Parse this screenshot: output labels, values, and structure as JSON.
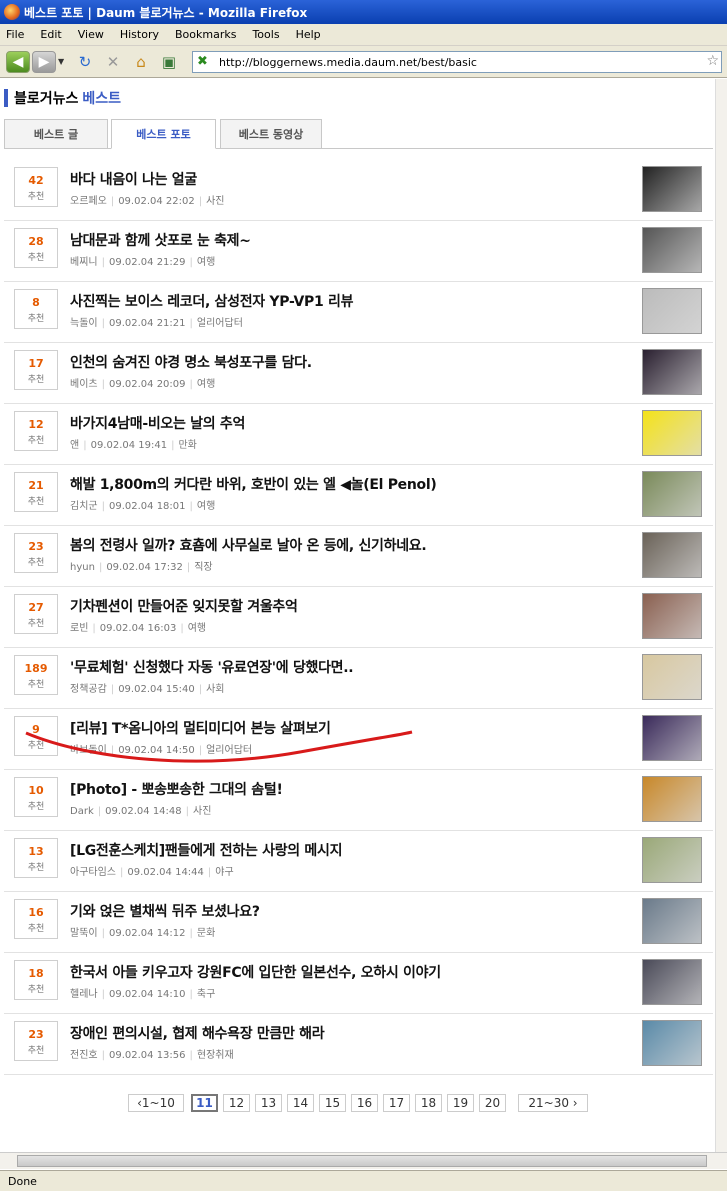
{
  "window": {
    "title": "베스트 포토 | Daum 블로거뉴스 - Mozilla Firefox"
  },
  "menu": [
    "File",
    "Edit",
    "View",
    "History",
    "Bookmarks",
    "Tools",
    "Help"
  ],
  "toolbar": {
    "url": "http://bloggernews.media.daum.net/best/basic"
  },
  "header": {
    "brand_main": "블로거뉴스",
    "brand_accent": "베스트"
  },
  "tabs": [
    {
      "label": "베스트 글",
      "active": false
    },
    {
      "label": "베스트 포토",
      "active": true
    },
    {
      "label": "베스트 동영상",
      "active": false
    }
  ],
  "vote_label": "추천",
  "items": [
    {
      "votes": "42",
      "title": "바다 내음이 나는 얼굴",
      "author": "오르페오",
      "date": "09.02.04 22:02",
      "category": "사진",
      "thumb_color": "#222"
    },
    {
      "votes": "28",
      "title": "남대문과 함께 삿포로 눈 축제~",
      "author": "베찌니",
      "date": "09.02.04 21:29",
      "category": "여행",
      "thumb_color": "#555"
    },
    {
      "votes": "8",
      "title": "사진찍는 보이스 레코더, 삼성전자 YP-VP1 리뷰",
      "author": "늑돌이",
      "date": "09.02.04 21:21",
      "category": "얼리어답터",
      "thumb_color": "#bbb"
    },
    {
      "votes": "17",
      "title": "인천의 숨겨진 야경 명소 북성포구를 담다.",
      "author": "베이츠",
      "date": "09.02.04 20:09",
      "category": "여행",
      "thumb_color": "#2a2030"
    },
    {
      "votes": "12",
      "title": "바가지4남매-비오는 날의 추억",
      "author": "앤",
      "date": "09.02.04 19:41",
      "category": "만화",
      "thumb_color": "#f4e21a"
    },
    {
      "votes": "21",
      "title": "해발 1,800m의 커다란 바위, 호반이 있는 엘 ◀놀(El Penol)",
      "author": "김치군",
      "date": "09.02.04 18:01",
      "category": "여행",
      "thumb_color": "#7a8a5a"
    },
    {
      "votes": "23",
      "title": "봄의 전령사 일까? 효춈에 사무실로 날아 온 등에, 신기하네요.",
      "author": "hyun",
      "date": "09.02.04 17:32",
      "category": "직장",
      "thumb_color": "#6a6258"
    },
    {
      "votes": "27",
      "title": "기차펜션이 만들어준 잊지못할 겨울추억",
      "author": "로빈",
      "date": "09.02.04 16:03",
      "category": "여행",
      "thumb_color": "#8a6050"
    },
    {
      "votes": "189",
      "title": "'무료체험' 신청했다 자동 '유료연장'에 당했다면..",
      "author": "정책공감",
      "date": "09.02.04 15:40",
      "category": "사회",
      "thumb_color": "#d8c8a0"
    },
    {
      "votes": "9",
      "title": "[리뷰] T*옴니아의 멀티미디어 본능 살펴보기",
      "author": "바보돌이",
      "date": "09.02.04 14:50",
      "category": "얼리어답터",
      "thumb_color": "#3a2a5a"
    },
    {
      "votes": "10",
      "title": "[Photo] - 뽀송뽀송한 그대의 솜털!",
      "author": "Dark",
      "date": "09.02.04 14:48",
      "category": "사진",
      "thumb_color": "#c8882a"
    },
    {
      "votes": "13",
      "title": "[LG전훈스케치]팬들에게 전하는 사랑의 메시지",
      "author": "아구타임스",
      "date": "09.02.04 14:44",
      "category": "야구",
      "thumb_color": "#9aa878"
    },
    {
      "votes": "16",
      "title": "기와 얹은 별채씩 뒤주 보셨나요?",
      "author": "말뚝이",
      "date": "09.02.04 14:12",
      "category": "문화",
      "thumb_color": "#6a7a8a"
    },
    {
      "votes": "18",
      "title": "한국서 아들 키우고자 강원FC에 입단한 일본선수, 오하시 이야기",
      "author": "헬레나",
      "date": "09.02.04 14:10",
      "category": "축구",
      "thumb_color": "#4a4a58"
    },
    {
      "votes": "23",
      "title": "장애인 편의시설, 협제 해수욕장 만큼만 해라",
      "author": "전진호",
      "date": "09.02.04 13:56",
      "category": "현장취재",
      "thumb_color": "#5a8aa8"
    }
  ],
  "pagination": {
    "prev": "1~10",
    "pages": [
      "11",
      "12",
      "13",
      "14",
      "15",
      "16",
      "17",
      "18",
      "19",
      "20"
    ],
    "current": "11",
    "next": "21~30"
  },
  "status": "Done"
}
